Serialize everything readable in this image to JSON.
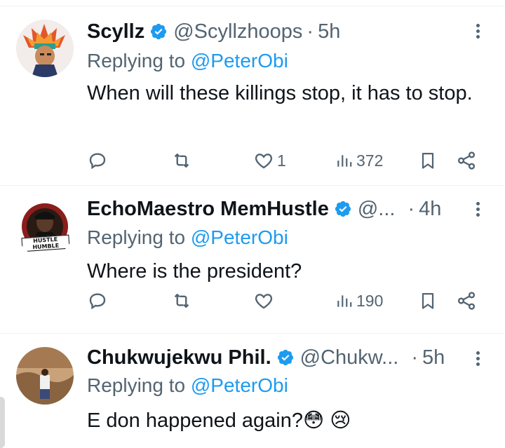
{
  "tweets": [
    {
      "name": "Scyllz",
      "handle": "@Scyllzhoops",
      "separator": "·",
      "time": "5h",
      "replying_label": "Replying to",
      "replying_to": "@PeterObi",
      "text": "When will these killings stop, it has to stop.",
      "likes": "1",
      "views": "372"
    },
    {
      "name": "EchoMaestro MemHustle",
      "handle": "@...",
      "separator": "·",
      "time": "4h",
      "replying_label": "Replying to",
      "replying_to": "@PeterObi",
      "text": "Where is the president?",
      "likes": "",
      "views": "190",
      "avatar_text": "HUSTLE HUMBLE"
    },
    {
      "name": "Chukwujekwu Phil.",
      "handle": "@Chukw...",
      "separator": "·",
      "time": "5h",
      "replying_label": "Replying to",
      "replying_to": "@PeterObi",
      "text": "E don happened again?😳 😢"
    }
  ],
  "colors": {
    "verified": "#1d9bf0",
    "mention": "#1d9bf0",
    "secondary_text": "#536471",
    "primary_text": "#0f1419",
    "divider": "#eff3f4"
  },
  "icons": [
    "reply-icon",
    "retweet-icon",
    "like-icon",
    "views-icon",
    "bookmark-icon",
    "share-icon",
    "more-icon",
    "verified-badge-icon"
  ]
}
